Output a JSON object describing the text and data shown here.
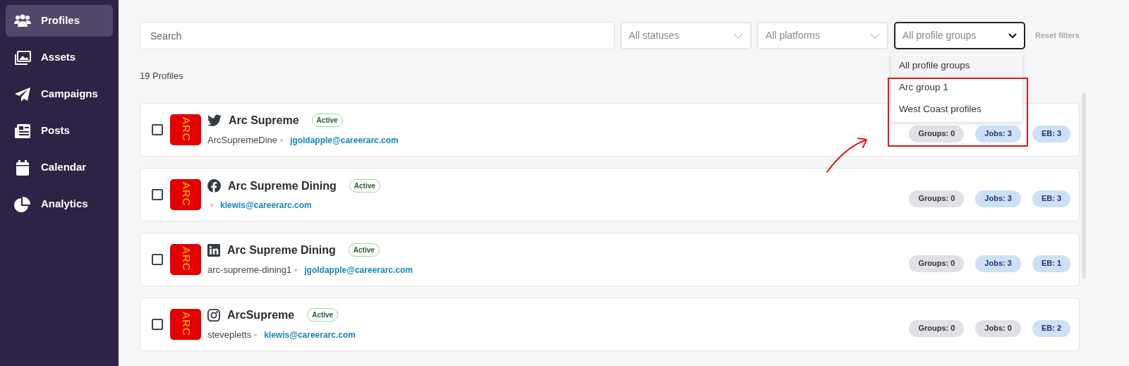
{
  "sidebar": {
    "items": [
      {
        "label": "Profiles",
        "selected": true
      },
      {
        "label": "Assets",
        "selected": false
      },
      {
        "label": "Campaigns",
        "selected": false
      },
      {
        "label": "Posts",
        "selected": false
      },
      {
        "label": "Calendar",
        "selected": false
      },
      {
        "label": "Analytics",
        "selected": false
      }
    ]
  },
  "filters": {
    "search": {
      "placeholder": "Search"
    },
    "selects": [
      {
        "placeholder": "All statuses",
        "open": false
      },
      {
        "placeholder": "All platforms",
        "open": false
      },
      {
        "placeholder": "All profile groups",
        "open": true,
        "options": [
          {
            "label": "All profile groups",
            "selected": true
          },
          {
            "label": "Arc group 1",
            "selected": false
          },
          {
            "label": "West Coast profiles",
            "selected": false
          }
        ]
      }
    ],
    "reset": "Reset filters"
  },
  "count": "19 Profiles",
  "profiles": [
    {
      "checked": false,
      "avatar_text": "ARC",
      "kind": "twitter",
      "name": "Arc Supreme",
      "status": "Active",
      "handle": "ArcSupremeDine",
      "email": "jgoldapple@careerarc.com",
      "pills": [
        {
          "label": "Groups: 0",
          "highlighted": false
        },
        {
          "label": "Jobs: 3",
          "highlighted": true
        },
        {
          "label": "EB: 3",
          "highlighted": true
        }
      ]
    },
    {
      "checked": false,
      "avatar_text": "ARC",
      "kind": "facebook",
      "name": "Arc Supreme Dining",
      "status": "Active",
      "email": "klewis@careerarc.com",
      "pills": [
        {
          "label": "Groups: 0",
          "highlighted": false
        },
        {
          "label": "Jobs: 3",
          "highlighted": true
        },
        {
          "label": "EB: 3",
          "highlighted": true
        }
      ]
    },
    {
      "checked": false,
      "avatar_text": "ARC",
      "kind": "linkedin",
      "name": "Arc Supreme Dining",
      "status": "Active",
      "handle": "arc-supreme-dining1",
      "email": "jgoldapple@careerarc.com",
      "pills": [
        {
          "label": "Groups: 0",
          "highlighted": false
        },
        {
          "label": "Jobs: 3",
          "highlighted": true
        },
        {
          "label": "EB: 1",
          "highlighted": true
        }
      ]
    },
    {
      "checked": false,
      "avatar_text": "ARC",
      "kind": "instagram",
      "name": "ArcSupreme",
      "status": "Active",
      "handle": "stevepletts",
      "email": "klewis@careerarc.com",
      "pills": [
        {
          "label": "Groups: 0",
          "highlighted": false
        },
        {
          "label": "Jobs: 0",
          "highlighted": false
        },
        {
          "label": "EB: 2",
          "highlighted": true
        }
      ]
    }
  ]
}
